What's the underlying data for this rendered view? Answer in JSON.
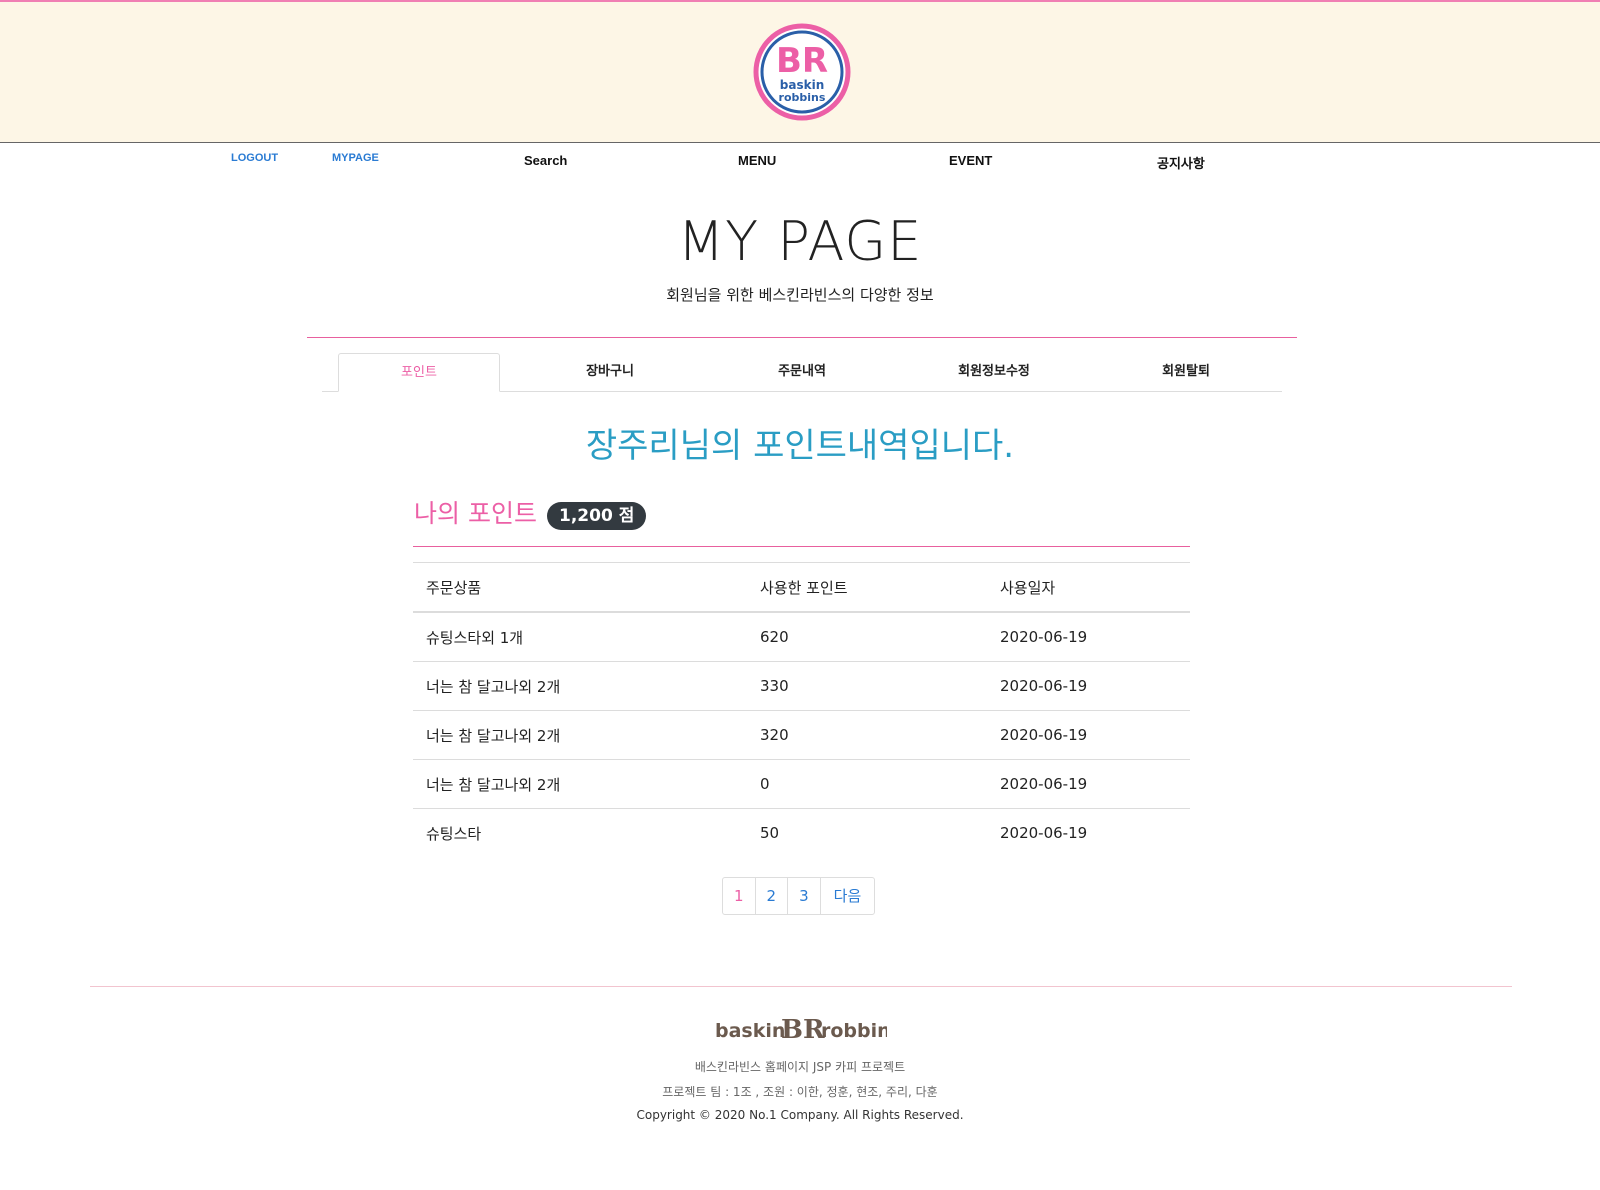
{
  "brand": {
    "logo_text_top": "BR",
    "logo_text_mid": "baskin",
    "logo_text_bot": "robbins"
  },
  "nav": {
    "logout": "LOGOUT",
    "mypage": "MYPAGE",
    "search": "Search",
    "menu": "MENU",
    "event": "EVENT",
    "notice": "공지사항"
  },
  "page": {
    "title": "MY PAGE",
    "subtitle": "회원님을 위한 베스킨라빈스의 다양한 정보"
  },
  "tabs": [
    "포인트",
    "장바구니",
    "주문내역",
    "회원정보수정",
    "회원탈퇴"
  ],
  "points": {
    "heading": "장주리님의 포인트내역입니다.",
    "my_points_label": "나의 포인트",
    "my_points_value": "1,200 점",
    "columns": [
      "주문상품",
      "사용한 포인트",
      "사용일자"
    ],
    "rows": [
      [
        "슈팅스타외 1개",
        "620",
        "2020-06-19"
      ],
      [
        "너는 참 달고나외 2개",
        "330",
        "2020-06-19"
      ],
      [
        "너는 참 달고나외 2개",
        "320",
        "2020-06-19"
      ],
      [
        "너는 참 달고나외 2개",
        "0",
        "2020-06-19"
      ],
      [
        "슈팅스타",
        "50",
        "2020-06-19"
      ]
    ]
  },
  "pagination": {
    "pages": [
      "1",
      "2",
      "3"
    ],
    "next": "다음",
    "current": "1"
  },
  "footer": {
    "logo_left": "baskin",
    "logo_mid": "BR",
    "logo_right": "robbins",
    "line1": "배스킨라빈스 홈페이지 JSP 카피 프로젝트",
    "line2": "프로젝트 팀 : 1조 , 조원 : 이한, 정훈, 현조, 주리, 다훈",
    "line3": "Copyright © 2020 No.1 Company. All Rights Reserved."
  },
  "colors": {
    "pink": "#ec5fa6",
    "blue": "#2a9dc4",
    "header_bg": "#fdf6e6",
    "link_blue": "#2a7bd3"
  }
}
